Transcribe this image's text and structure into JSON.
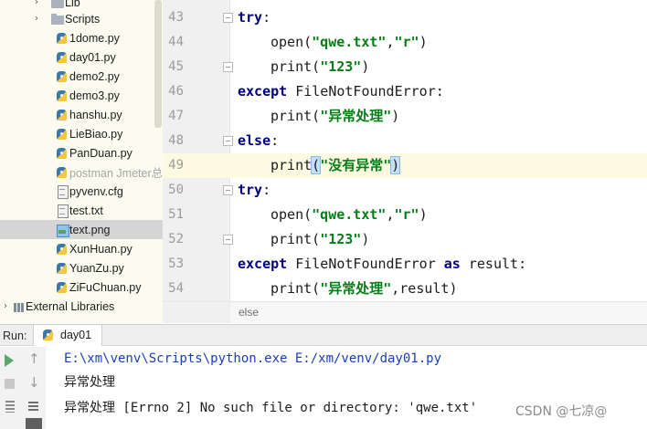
{
  "project_tree": {
    "items": [
      {
        "label": "Lib",
        "icon": "folder-icon",
        "arrow": "›"
      },
      {
        "label": "Scripts",
        "icon": "folder-icon",
        "arrow": "›"
      },
      {
        "label": "1dome.py",
        "icon": "python-file-icon"
      },
      {
        "label": "day01.py",
        "icon": "python-file-icon"
      },
      {
        "label": "demo2.py",
        "icon": "python-file-icon"
      },
      {
        "label": "demo3.py",
        "icon": "python-file-icon"
      },
      {
        "label": "hanshu.py",
        "icon": "python-file-icon"
      },
      {
        "label": "LieBiao.py",
        "icon": "python-file-icon"
      },
      {
        "label": "PanDuan.py",
        "icon": "python-file-icon"
      },
      {
        "label": "postman Jmeter总",
        "icon": "python-file-icon",
        "muted": true
      },
      {
        "label": "pyvenv.cfg",
        "icon": "text-file-icon"
      },
      {
        "label": "test.txt",
        "icon": "text-file-icon"
      },
      {
        "label": "text.png",
        "icon": "image-file-icon",
        "selected": true
      },
      {
        "label": "XunHuan.py",
        "icon": "python-file-icon"
      },
      {
        "label": "YuanZu.py",
        "icon": "python-file-icon"
      },
      {
        "label": "ZiFuChuan.py",
        "icon": "python-file-icon"
      },
      {
        "label": "External Libraries",
        "icon": "library-icon",
        "arrow": "›"
      }
    ]
  },
  "editor": {
    "lines": [
      {
        "num": "43",
        "tokens": [
          [
            "kw",
            "try"
          ],
          [
            "pun",
            ":"
          ]
        ],
        "indent": 0,
        "fold": true
      },
      {
        "num": "44",
        "tokens": [
          [
            "fn",
            "open"
          ],
          [
            "pun",
            "("
          ],
          [
            "str",
            "\"qwe.txt\""
          ],
          [
            "pun",
            ","
          ],
          [
            "str",
            "\"r\""
          ],
          [
            "pun",
            ")"
          ]
        ],
        "indent": 1
      },
      {
        "num": "45",
        "tokens": [
          [
            "fn",
            "print"
          ],
          [
            "pun",
            "("
          ],
          [
            "str",
            "\"123\""
          ],
          [
            "pun",
            ")"
          ]
        ],
        "indent": 1,
        "fold": true
      },
      {
        "num": "46",
        "tokens": [
          [
            "kw",
            "except"
          ],
          [
            "fn",
            " FileNotFoundError"
          ],
          [
            "pun",
            ":"
          ]
        ],
        "indent": 0
      },
      {
        "num": "47",
        "tokens": [
          [
            "fn",
            "print"
          ],
          [
            "pun",
            "("
          ],
          [
            "str",
            "\"异常处理\""
          ],
          [
            "pun",
            ")"
          ]
        ],
        "indent": 1
      },
      {
        "num": "48",
        "tokens": [
          [
            "kw",
            "else"
          ],
          [
            "pun",
            ":"
          ]
        ],
        "indent": 0,
        "fold": true
      },
      {
        "num": "49",
        "tokens": [
          [
            "fn",
            "print"
          ],
          [
            "bracket",
            "("
          ],
          [
            "str",
            "\"没有异常\""
          ],
          [
            "bracket",
            ")"
          ]
        ],
        "indent": 1,
        "current": true
      },
      {
        "num": "50",
        "tokens": [
          [
            "kw",
            "try"
          ],
          [
            "pun",
            ":"
          ]
        ],
        "indent": 0,
        "fold": true
      },
      {
        "num": "51",
        "tokens": [
          [
            "fn",
            "open"
          ],
          [
            "pun",
            "("
          ],
          [
            "str",
            "\"qwe.txt\""
          ],
          [
            "pun",
            ","
          ],
          [
            "str",
            "\"r\""
          ],
          [
            "pun",
            ")"
          ]
        ],
        "indent": 1
      },
      {
        "num": "52",
        "tokens": [
          [
            "fn",
            "print"
          ],
          [
            "pun",
            "("
          ],
          [
            "str",
            "\"123\""
          ],
          [
            "pun",
            ")"
          ]
        ],
        "indent": 1,
        "fold": true
      },
      {
        "num": "53",
        "tokens": [
          [
            "kw",
            "except"
          ],
          [
            "fn",
            " FileNotFoundError "
          ],
          [
            "kw",
            "as"
          ],
          [
            "fn",
            " result"
          ],
          [
            "pun",
            ":"
          ]
        ],
        "indent": 0
      },
      {
        "num": "54",
        "tokens": [
          [
            "fn",
            "print"
          ],
          [
            "pun",
            "("
          ],
          [
            "str",
            "\"异常处理\""
          ],
          [
            "pun",
            ","
          ],
          [
            "fn",
            "result"
          ],
          [
            "pun",
            ")"
          ]
        ],
        "indent": 1
      }
    ],
    "breadcrumb": "else"
  },
  "run_panel": {
    "label": "Run:",
    "tab_label": "day01",
    "tab_icon": "python-file-icon",
    "output": [
      {
        "text": "E:\\xm\\venv\\Scripts\\python.exe E:/xm/venv/day01.py",
        "kind": "cmd"
      },
      {
        "text": "异常处理",
        "kind": "out"
      },
      {
        "text": "异常处理 [Errno 2] No such file or directory: 'qwe.txt'",
        "kind": "out"
      }
    ]
  },
  "watermark": "CSDN @七凉@",
  "colors": {
    "keyword": "#00007f",
    "string": "#067d17",
    "current_line": "#fcfae0",
    "tree_background": "#fbfbf0",
    "selected_row": "#d5d5d5"
  }
}
